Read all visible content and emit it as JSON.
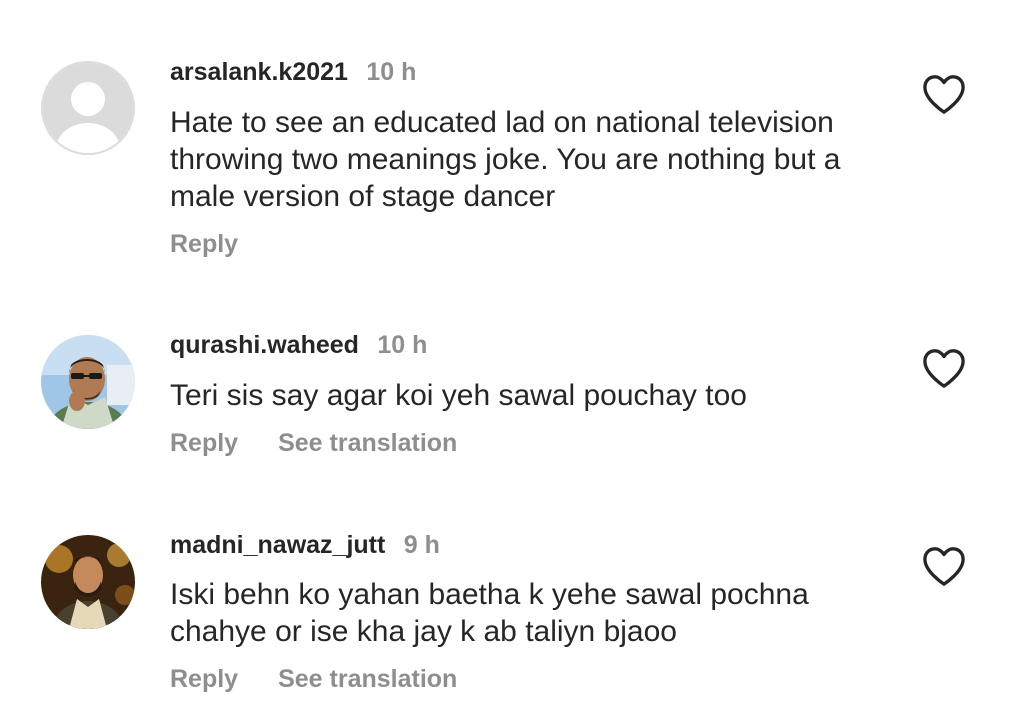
{
  "comments": [
    {
      "username": "arsalank.k2021",
      "time": "10 h",
      "text": "Hate to see an educated lad on national television\nthrowing two meanings joke. You are nothing but a\nmale version of stage dancer",
      "reply_label": "Reply",
      "avatar": "default-avatar-icon"
    },
    {
      "username": "qurashi.waheed",
      "time": "10 h",
      "text": "Teri sis say agar koi yeh sawal pouchay too",
      "reply_label": "Reply",
      "translate_label": "See translation",
      "avatar": "user-photo"
    },
    {
      "username": "madni_nawaz_jutt",
      "time": "9 h",
      "text": "Iski behn ko yahan baetha k yehe sawal pochna\nchahye or ise kha jay k ab taliyn bjaoo",
      "reply_label": "Reply",
      "translate_label": "See translation",
      "avatar": "user-photo"
    }
  ],
  "colors": {
    "primary_text": "#262626",
    "secondary_text": "#8e8e8e",
    "heart_stroke": "#262626"
  },
  "icons": {
    "like": "heart-outline-icon"
  }
}
